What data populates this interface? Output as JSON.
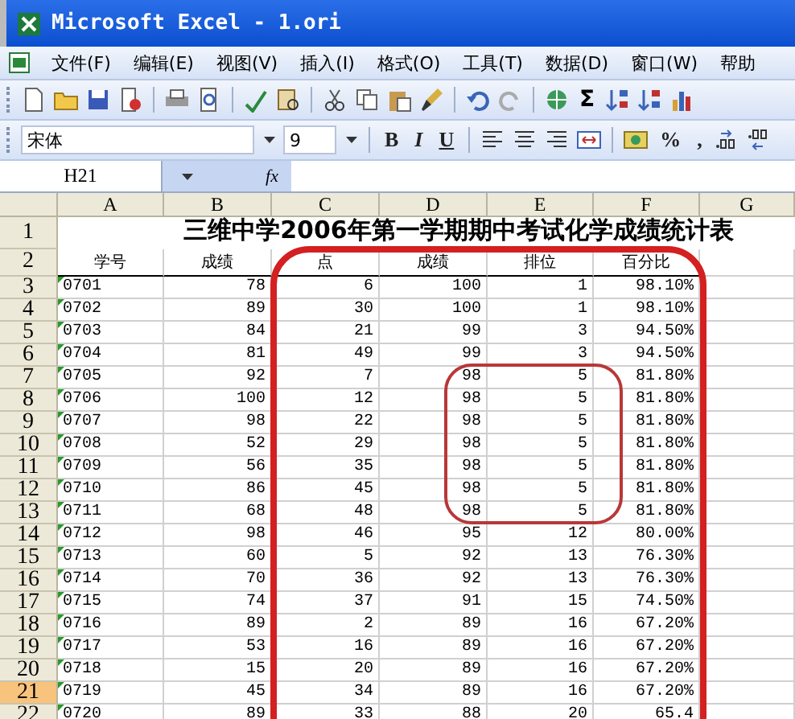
{
  "window": {
    "title": "Microsoft Excel - 1.ori"
  },
  "menu": [
    {
      "label": "文件(F)"
    },
    {
      "label": "编辑(E)"
    },
    {
      "label": "视图(V)"
    },
    {
      "label": "插入(I)"
    },
    {
      "label": "格式(O)"
    },
    {
      "label": "工具(T)"
    },
    {
      "label": "数据(D)"
    },
    {
      "label": "窗口(W)"
    },
    {
      "label": "帮助"
    }
  ],
  "standard_toolbar": {
    "sum": "Σ"
  },
  "format_toolbar": {
    "font": "宋体",
    "size": "9",
    "buttons": [
      "B",
      "I",
      "U"
    ],
    "percent": "%",
    "comma": ","
  },
  "formula_bar": {
    "name_box": "H21",
    "fx": "fx"
  },
  "sheet": {
    "columns": [
      "A",
      "B",
      "C",
      "D",
      "E",
      "F",
      "G"
    ],
    "title_row": "1",
    "title": "三维中学2006年第一学期期中考试化学成绩统计表",
    "header_row": "2",
    "headers": [
      "学号",
      "成绩",
      "点",
      "成绩",
      "排位",
      "百分比"
    ],
    "rows": [
      {
        "number": "3",
        "selected": false,
        "warning": true,
        "cells": [
          "0701",
          "78",
          "6",
          "100",
          "1",
          "98.10%"
        ]
      },
      {
        "number": "4",
        "selected": false,
        "warning": true,
        "cells": [
          "0702",
          "89",
          "30",
          "100",
          "1",
          "98.10%"
        ]
      },
      {
        "number": "5",
        "selected": false,
        "warning": true,
        "cells": [
          "0703",
          "84",
          "21",
          "99",
          "3",
          "94.50%"
        ]
      },
      {
        "number": "6",
        "selected": false,
        "warning": true,
        "cells": [
          "0704",
          "81",
          "49",
          "99",
          "3",
          "94.50%"
        ]
      },
      {
        "number": "7",
        "selected": false,
        "warning": true,
        "cells": [
          "0705",
          "92",
          "7",
          "98",
          "5",
          "81.80%"
        ]
      },
      {
        "number": "8",
        "selected": false,
        "warning": true,
        "cells": [
          "0706",
          "100",
          "12",
          "98",
          "5",
          "81.80%"
        ]
      },
      {
        "number": "9",
        "selected": false,
        "warning": true,
        "cells": [
          "0707",
          "98",
          "22",
          "98",
          "5",
          "81.80%"
        ]
      },
      {
        "number": "10",
        "selected": false,
        "warning": true,
        "cells": [
          "0708",
          "52",
          "29",
          "98",
          "5",
          "81.80%"
        ]
      },
      {
        "number": "11",
        "selected": false,
        "warning": true,
        "cells": [
          "0709",
          "56",
          "35",
          "98",
          "5",
          "81.80%"
        ]
      },
      {
        "number": "12",
        "selected": false,
        "warning": true,
        "cells": [
          "0710",
          "86",
          "45",
          "98",
          "5",
          "81.80%"
        ]
      },
      {
        "number": "13",
        "selected": false,
        "warning": true,
        "cells": [
          "0711",
          "68",
          "48",
          "98",
          "5",
          "81.80%"
        ]
      },
      {
        "number": "14",
        "selected": false,
        "warning": true,
        "cells": [
          "0712",
          "98",
          "46",
          "95",
          "12",
          "80.00%"
        ]
      },
      {
        "number": "15",
        "selected": false,
        "warning": true,
        "cells": [
          "0713",
          "60",
          "5",
          "92",
          "13",
          "76.30%"
        ]
      },
      {
        "number": "16",
        "selected": false,
        "warning": true,
        "cells": [
          "0714",
          "70",
          "36",
          "92",
          "13",
          "76.30%"
        ]
      },
      {
        "number": "17",
        "selected": false,
        "warning": true,
        "cells": [
          "0715",
          "74",
          "37",
          "91",
          "15",
          "74.50%"
        ]
      },
      {
        "number": "18",
        "selected": false,
        "warning": true,
        "cells": [
          "0716",
          "89",
          "2",
          "89",
          "16",
          "67.20%"
        ]
      },
      {
        "number": "19",
        "selected": false,
        "warning": true,
        "cells": [
          "0717",
          "53",
          "16",
          "89",
          "16",
          "67.20%"
        ]
      },
      {
        "number": "20",
        "selected": false,
        "warning": true,
        "cells": [
          "0718",
          "15",
          "20",
          "89",
          "16",
          "67.20%"
        ]
      },
      {
        "number": "21",
        "selected": true,
        "warning": true,
        "cells": [
          "0719",
          "45",
          "34",
          "89",
          "16",
          "67.20%"
        ]
      },
      {
        "number": "22",
        "selected": false,
        "warning": true,
        "cells": [
          "0720",
          "89",
          "33",
          "88",
          "20",
          "65.4"
        ]
      }
    ]
  }
}
